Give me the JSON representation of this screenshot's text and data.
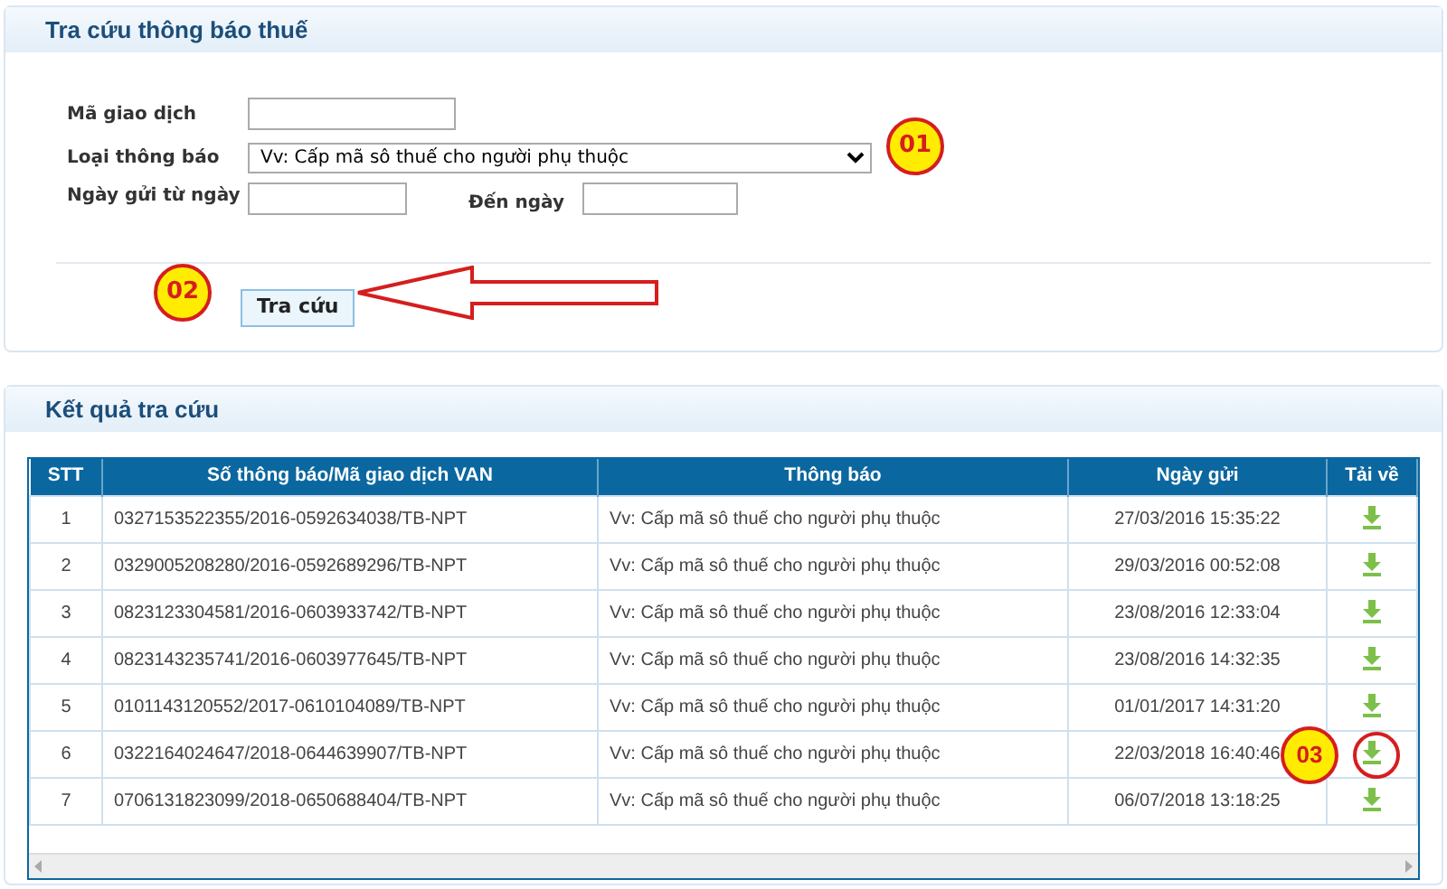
{
  "search_panel": {
    "title": "Tra cứu thông báo thuế",
    "transaction_code": {
      "label": "Mã giao dịch"
    },
    "notice_type": {
      "label": "Loại thông báo",
      "value": "Vv: Cấp mã sô thuế cho người phụ thuộc",
      "callout": "01"
    },
    "sent_from": {
      "label": "Ngày gửi từ ngày"
    },
    "sent_to": {
      "label": "Đến ngày"
    },
    "search_button": {
      "label": "Tra cứu",
      "callout": "02"
    }
  },
  "results_panel": {
    "title": "Kết quả tra cứu",
    "table": {
      "columns": [
        "STT",
        "Số thông báo/Mã giao dịch VAN",
        "Thông báo",
        "Ngày gửi",
        "Tải về"
      ],
      "rows": [
        {
          "stt": "1",
          "code": "0327153522355/2016-0592634038/TB-NPT",
          "notice": "Vv: Cấp mã sô thuế cho người phụ thuộc",
          "date": "27/03/2016 15:35:22",
          "highlighted": false
        },
        {
          "stt": "2",
          "code": "0329005208280/2016-0592689296/TB-NPT",
          "notice": "Vv: Cấp mã sô thuế cho người phụ thuộc",
          "date": "29/03/2016 00:52:08",
          "highlighted": false
        },
        {
          "stt": "3",
          "code": "0823123304581/2016-0603933742/TB-NPT",
          "notice": "Vv: Cấp mã sô thuế cho người phụ thuộc",
          "date": "23/08/2016 12:33:04",
          "highlighted": false
        },
        {
          "stt": "4",
          "code": "0823143235741/2016-0603977645/TB-NPT",
          "notice": "Vv: Cấp mã sô thuế cho người phụ thuộc",
          "date": "23/08/2016 14:32:35",
          "highlighted": false
        },
        {
          "stt": "5",
          "code": "0101143120552/2017-0610104089/TB-NPT",
          "notice": "Vv: Cấp mã sô thuế cho người phụ thuộc",
          "date": "01/01/2017 14:31:20",
          "highlighted": false
        },
        {
          "stt": "6",
          "code": "0322164024647/2018-0644639907/TB-NPT",
          "notice": "Vv: Cấp mã sô thuế cho người phụ thuộc",
          "date": "22/03/2018 16:40:46",
          "highlighted": true,
          "callout": "03"
        },
        {
          "stt": "7",
          "code": "0706131823099/2018-0650688404/TB-NPT",
          "notice": "Vv: Cấp mã sô thuế cho người phụ thuộc",
          "date": "06/07/2018 13:18:25",
          "highlighted": false
        }
      ]
    }
  }
}
